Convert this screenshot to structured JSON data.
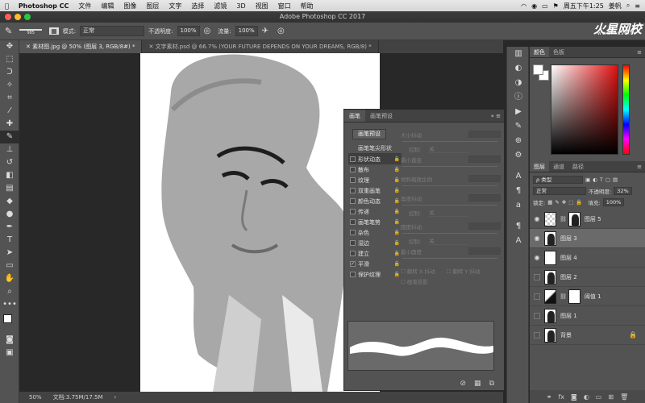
{
  "menubar": {
    "apple": "",
    "app_name": "Photoshop CC",
    "items": [
      "文件",
      "编辑",
      "图像",
      "图层",
      "文字",
      "选择",
      "滤镜",
      "3D",
      "视图",
      "窗口",
      "帮助"
    ],
    "clock": "周五下午1:25",
    "user": "姜帆"
  },
  "titlebar": {
    "title": "Adobe Photoshop CC 2017"
  },
  "options": {
    "brush_size": "985",
    "mode_label": "模式:",
    "mode_value": "正常",
    "opacity_label": "不透明度:",
    "opacity_value": "100%",
    "flow_label": "流量:",
    "flow_value": "100%"
  },
  "watermark": {
    "text": "火星网校",
    "sub": "www.hxsd.tv"
  },
  "doc_tabs": [
    {
      "label": "素材图.jpg @ 50% (图层 3, RGB/8#) *"
    },
    {
      "label": "文字素材.psd @ 66.7% (YOUR FUTURE DEPENDS ON YOUR DREAMS, RGB/8) *"
    }
  ],
  "status": {
    "zoom": "50%",
    "doc": "文档:3.75M/17.5M"
  },
  "brush_panel": {
    "tabs": [
      "画笔",
      "画笔预设"
    ],
    "presets_button": "画笔预设",
    "section_header": "画笔笔尖形状",
    "options": [
      {
        "label": "形状动态",
        "checked": false
      },
      {
        "label": "散布",
        "checked": false
      },
      {
        "label": "纹理",
        "checked": false
      },
      {
        "label": "双重画笔",
        "checked": false
      },
      {
        "label": "颜色动态",
        "checked": false
      },
      {
        "label": "传递",
        "checked": false
      },
      {
        "label": "画笔笔势",
        "checked": false
      },
      {
        "label": "杂色",
        "checked": false
      },
      {
        "label": "湿边",
        "checked": false
      },
      {
        "label": "建立",
        "checked": false
      },
      {
        "label": "平滑",
        "checked": true
      },
      {
        "label": "保护纹理",
        "checked": false
      }
    ],
    "controls": {
      "size_jitter": "大小抖动",
      "control1": "控制:",
      "off1": "关",
      "min_diameter": "最小直径",
      "tilt_scale": "倾斜缩放比例",
      "angle_jitter": "角度抖动",
      "control2": "控制:",
      "off2": "关",
      "roundness_jitter": "圆度抖动",
      "control3": "控制:",
      "off3": "关",
      "min_roundness": "最小圆度",
      "flip_x": "翻转 X 抖动",
      "flip_y": "翻转 Y 抖动",
      "brush_projection": "画笔投影"
    }
  },
  "color_panel": {
    "tabs": [
      "颜色",
      "色板"
    ]
  },
  "layers_panel": {
    "tabs": [
      "图层",
      "通道",
      "路径"
    ],
    "kind_label": "ρ 类型",
    "blend_mode": "正常",
    "opacity_label": "不透明度:",
    "opacity_value": "32%",
    "lock_label": "锁定:",
    "fill_label": "填充:",
    "fill_value": "100%",
    "layers": [
      {
        "name": "图层 5",
        "visible": true,
        "selected": false
      },
      {
        "name": "图层 3",
        "visible": true,
        "selected": true
      },
      {
        "name": "图层 4",
        "visible": true,
        "selected": false
      },
      {
        "name": "图层 2",
        "visible": false,
        "selected": false
      },
      {
        "name": "阈值 1",
        "visible": false,
        "selected": false
      },
      {
        "name": "图层 1",
        "visible": false,
        "selected": false
      },
      {
        "name": "背景",
        "visible": false,
        "selected": false
      }
    ]
  },
  "colors": {
    "ui_bg": "#535353",
    "canvas_bg": "#282828",
    "picker_hue": "#e21010"
  }
}
